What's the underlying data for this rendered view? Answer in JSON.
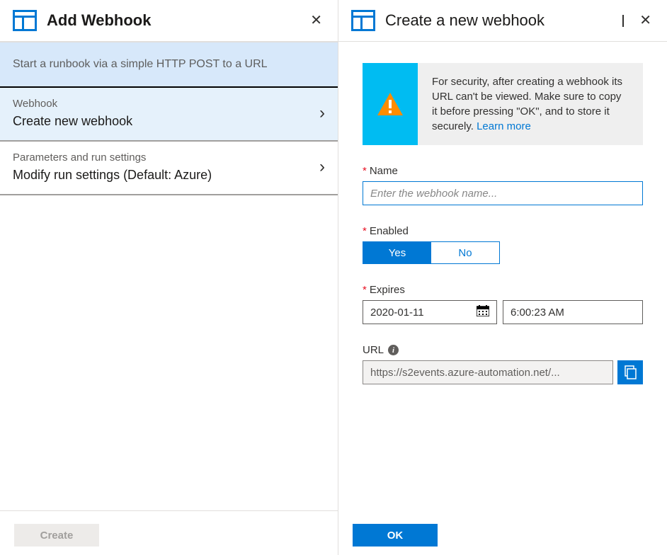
{
  "left": {
    "title": "Add Webhook",
    "sub_header": "Start a runbook via a simple HTTP POST to a URL",
    "items": [
      {
        "label": "Webhook",
        "value": "Create new webhook"
      },
      {
        "label": "Parameters and run settings",
        "value": "Modify run settings (Default: Azure)"
      }
    ],
    "create_btn": "Create"
  },
  "right": {
    "title": "Create a new webhook",
    "info_text": "For security, after creating a webhook its URL can't be viewed. Make sure to copy it before pressing \"OK\", and to store it securely. ",
    "info_link": "Learn more",
    "name_label": "Name",
    "name_placeholder": "Enter the webhook name...",
    "enabled_label": "Enabled",
    "enabled_yes": "Yes",
    "enabled_no": "No",
    "expires_label": "Expires",
    "expires_date": "2020-01-11",
    "expires_time": "6:00:23 AM",
    "url_label": "URL",
    "url_value": "https://s2events.azure-automation.net/...",
    "ok_btn": "OK"
  }
}
